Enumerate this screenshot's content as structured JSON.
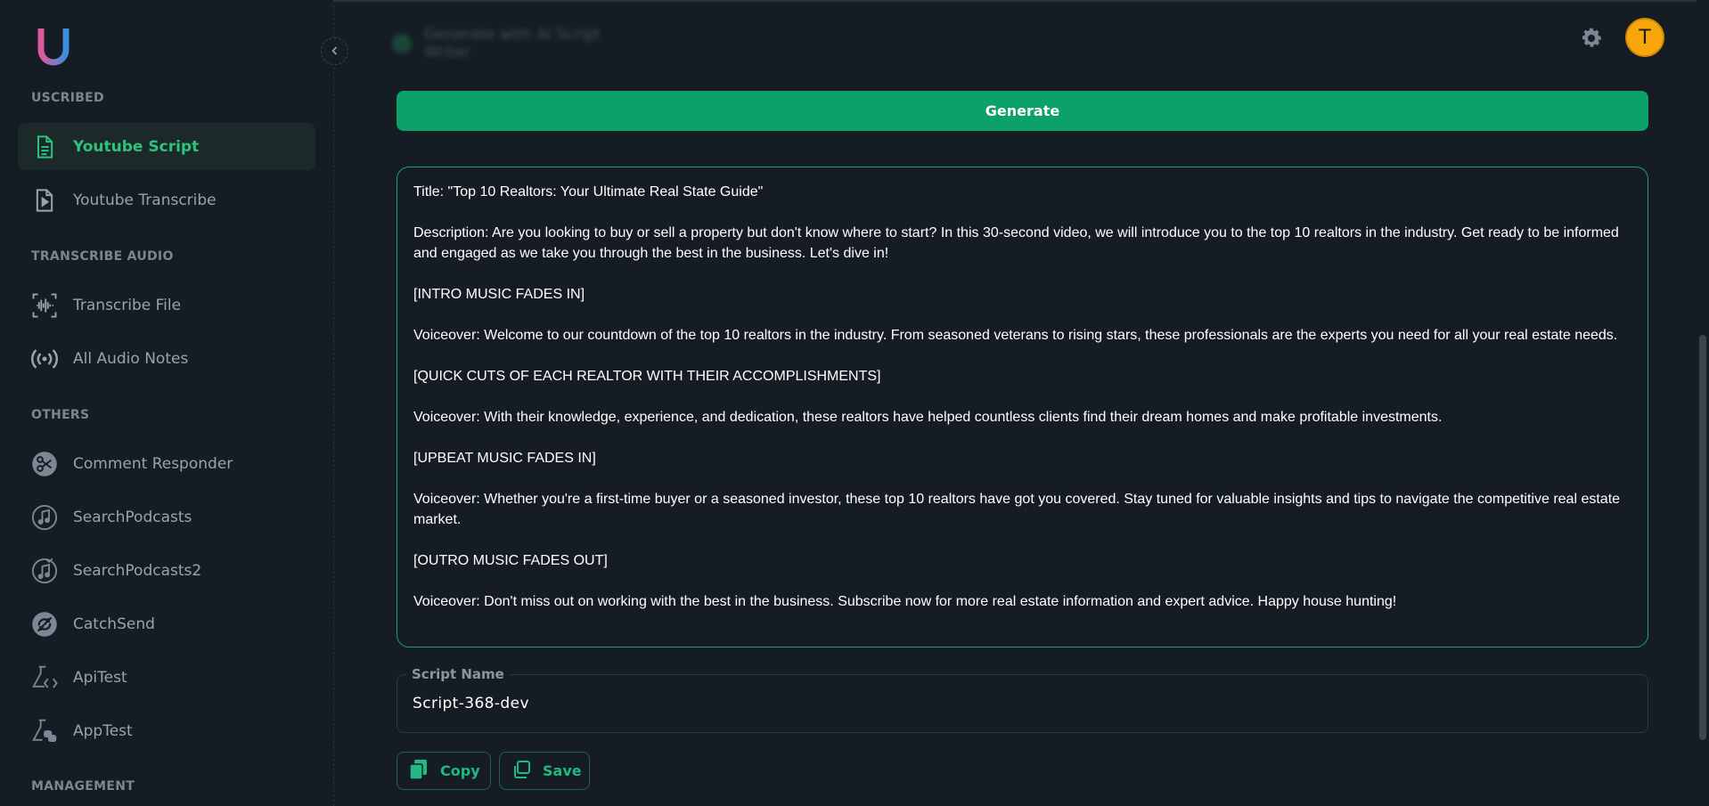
{
  "app": {
    "logo_letter": "U",
    "avatar_initial": "T",
    "header_blurred_text": "Generate with AI Script Writer"
  },
  "sidebar": {
    "sections": [
      {
        "label": "USCRIBED"
      },
      {
        "label": "TRANSCRIBE AUDIO"
      },
      {
        "label": "OTHERS"
      },
      {
        "label": "MANAGEMENT"
      }
    ],
    "items": [
      {
        "label": "Youtube Script",
        "icon": "document-icon",
        "active": true
      },
      {
        "label": "Youtube Transcribe",
        "icon": "play-file-icon"
      },
      {
        "label": "Transcribe File",
        "icon": "waveform-icon"
      },
      {
        "label": "All Audio Notes",
        "icon": "broadcast-icon"
      },
      {
        "label": "Comment Responder",
        "icon": "scissors-icon"
      },
      {
        "label": "SearchPodcasts",
        "icon": "music-note-icon"
      },
      {
        "label": "SearchPodcasts2",
        "icon": "music-note-search-icon"
      },
      {
        "label": "CatchSend",
        "icon": "sync-icon"
      },
      {
        "label": "ApiTest",
        "icon": "flask-code-icon"
      },
      {
        "label": "AppTest",
        "icon": "flask-python-icon"
      }
    ]
  },
  "main": {
    "generate_label": "Generate",
    "script_paragraphs": [
      "Title: \"Top 10 Realtors: Your Ultimate Real State Guide\"",
      "Description: Are you looking to buy or sell a property but don't know where to start? In this 30-second video, we will introduce you to the top 10 realtors in the industry. Get ready to be informed and engaged as we take you through the best in the business. Let's dive in!",
      "[INTRO MUSIC FADES IN]",
      "Voiceover: Welcome to our countdown of the top 10 realtors in the industry. From seasoned veterans to rising stars, these professionals are the experts you need for all your real estate needs.",
      "[QUICK CUTS OF EACH REALTOR WITH THEIR ACCOMPLISHMENTS]",
      "Voiceover: With their knowledge, experience, and dedication, these realtors have helped countless clients find their dream homes and make profitable investments.",
      "[UPBEAT MUSIC FADES IN]",
      "Voiceover: Whether you're a first-time buyer or a seasoned investor, these top 10 realtors have got you covered. Stay tuned for valuable insights and tips to navigate the competitive real estate market.",
      "[OUTRO MUSIC FADES OUT]",
      "Voiceover: Don't miss out on working with the best in the business. Subscribe now for more real estate information and expert advice. Happy house hunting!"
    ],
    "script_name_label": "Script Name",
    "script_name_value": "Script-368-dev",
    "copy_label": "Copy",
    "save_label": "Save"
  },
  "colors": {
    "background": "#161c24",
    "accent": "#0ca16b",
    "active_text": "#2ec27e",
    "avatar": "#f7a70c"
  }
}
